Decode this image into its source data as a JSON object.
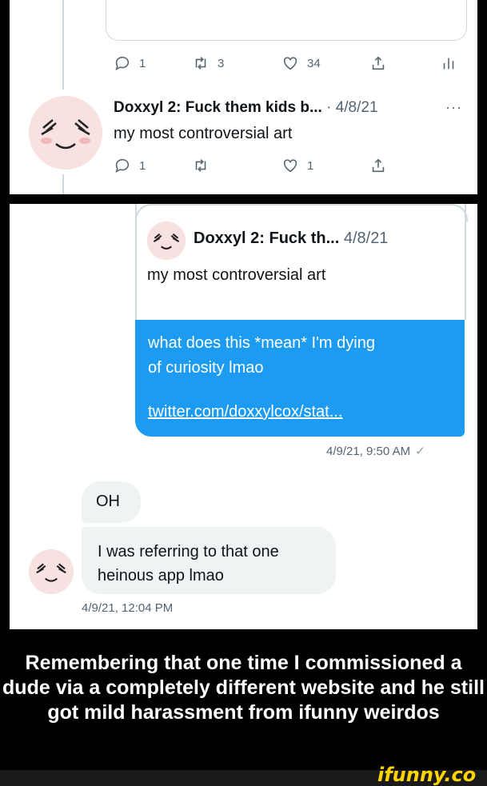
{
  "tweet_panel": {
    "prev_actions": {
      "replies": "1",
      "retweets": "3",
      "likes": "34"
    },
    "author_name": "Doxxyl 2: Fuck them kids b...",
    "date_sep": "·",
    "date": "4/8/21",
    "more": "···",
    "text": "my most controversial art",
    "actions": {
      "replies": "1",
      "retweets": "",
      "likes": "1"
    }
  },
  "dm_panel": {
    "quote": {
      "author_name": "Doxxyl 2: Fuck th...",
      "date": "4/8/21",
      "text": "my most controversial art"
    },
    "sent_message": {
      "text": "what does this *mean* I'm dying of curiosity lmao",
      "link": "twitter.com/doxxylcox/stat...",
      "timestamp": "4/9/21, 9:50 AM",
      "read_mark": "✓"
    },
    "received": [
      {
        "text": "OH"
      },
      {
        "text": "I was referring to that one heinous app lmao"
      }
    ],
    "received_timestamp": "4/9/21, 12:04 PM"
  },
  "caption": "Remembering that one time I commissioned a dude via a completely different website and he still got mild harassment from ifunny weirdos",
  "watermark": "ifunny.co",
  "colors": {
    "twitter_blue": "#1d9bf0",
    "watermark_yellow": "#ffd400"
  },
  "icons": [
    "reply-icon",
    "retweet-icon",
    "like-icon",
    "share-icon",
    "analytics-icon",
    "more-icon"
  ]
}
